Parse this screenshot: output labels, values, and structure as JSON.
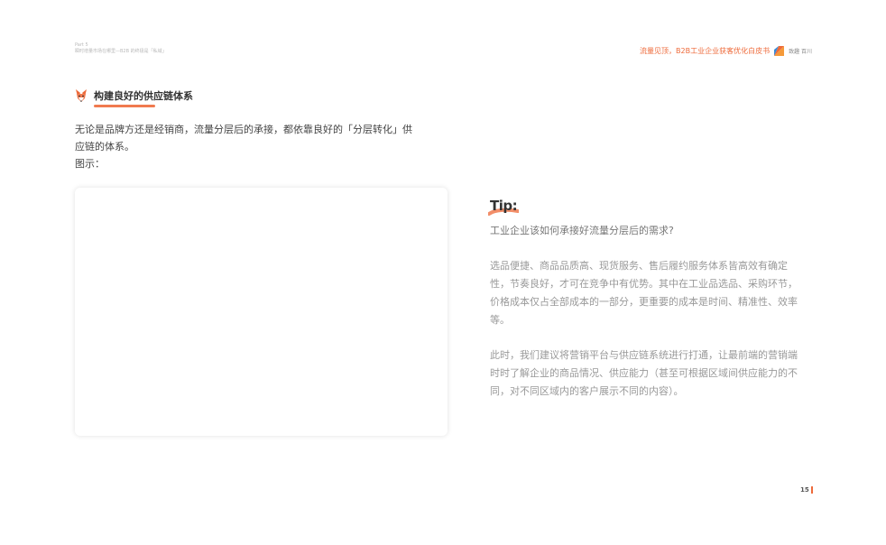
{
  "header": {
    "part": "Part 5",
    "subtitle": "瞬时增量市场在哪里—B2B 的终极是「私域」",
    "doc_title": "流量见顶，B2B工业企业获客优化白皮书",
    "logo_text": "致趣 百川"
  },
  "section": {
    "icon": "fox-icon",
    "title": "构建良好的供应链体系"
  },
  "intro": {
    "line1": "无论是品牌方还是经销商，流量分层后的承接，都依靠良好的「分层转化」供",
    "line2": "应链的体系。",
    "line3": "图示："
  },
  "tip": {
    "title": "Tip:",
    "question": "工业企业该如何承接好流量分层后的需求?",
    "paragraph1": "选品便捷、商品品质高、现货服务、售后履约服务体系皆高效有确定性，节奏良好，才可在竞争中有优势。其中在工业品选品、采购环节，价格成本仅占全部成本的一部分，更重要的成本是时间、精准性、效率等。",
    "paragraph2": "此时，我们建议将营销平台与供应链系统进行打通，让最前端的营销端时时了解企业的商品情况、供应能力（甚至可根据区域间供应能力的不同，对不同区域内的客户展示不同的内容）。"
  },
  "page": {
    "number": "15"
  },
  "colors": {
    "accent": "#ee6a3a"
  }
}
